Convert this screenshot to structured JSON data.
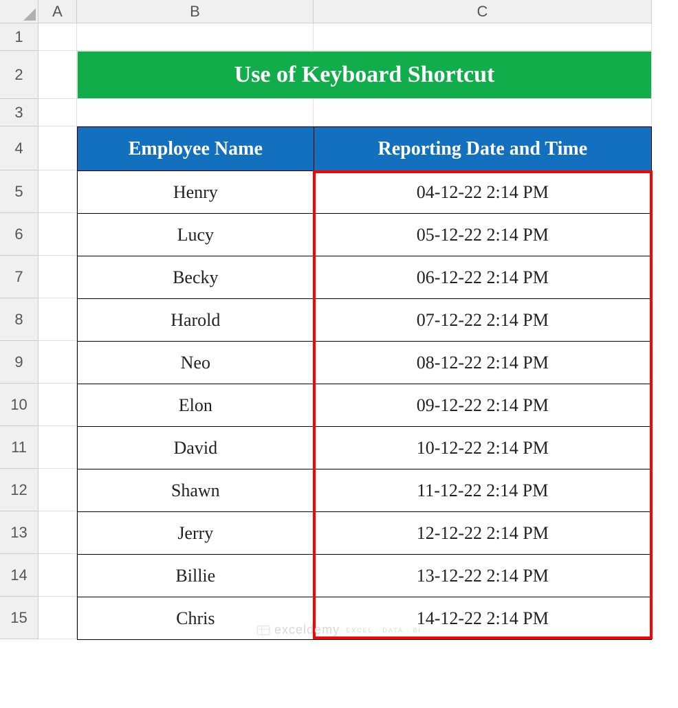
{
  "columns": {
    "A": "A",
    "B": "B",
    "C": "C"
  },
  "rows": [
    "1",
    "2",
    "3",
    "4",
    "5",
    "6",
    "7",
    "8",
    "9",
    "10",
    "11",
    "12",
    "13",
    "14",
    "15"
  ],
  "title": "Use of Keyboard Shortcut",
  "headers": {
    "name": "Employee Name",
    "datetime": "Reporting Date and Time"
  },
  "data": [
    {
      "name": "Henry",
      "datetime": "04-12-22 2:14 PM"
    },
    {
      "name": "Lucy",
      "datetime": "05-12-22 2:14 PM"
    },
    {
      "name": "Becky",
      "datetime": "06-12-22 2:14 PM"
    },
    {
      "name": "Harold",
      "datetime": "07-12-22 2:14 PM"
    },
    {
      "name": "Neo",
      "datetime": "08-12-22 2:14 PM"
    },
    {
      "name": "Elon",
      "datetime": "09-12-22 2:14 PM"
    },
    {
      "name": "David",
      "datetime": "10-12-22 2:14 PM"
    },
    {
      "name": "Shawn",
      "datetime": "11-12-22 2:14 PM"
    },
    {
      "name": "Jerry",
      "datetime": "12-12-22 2:14 PM"
    },
    {
      "name": "Billie",
      "datetime": "13-12-22 2:14 PM"
    },
    {
      "name": "Chris",
      "datetime": "14-12-22 2:14 PM"
    }
  ],
  "watermark": {
    "text": "exceldemy",
    "sub": "EXCEL · DATA · BI"
  }
}
